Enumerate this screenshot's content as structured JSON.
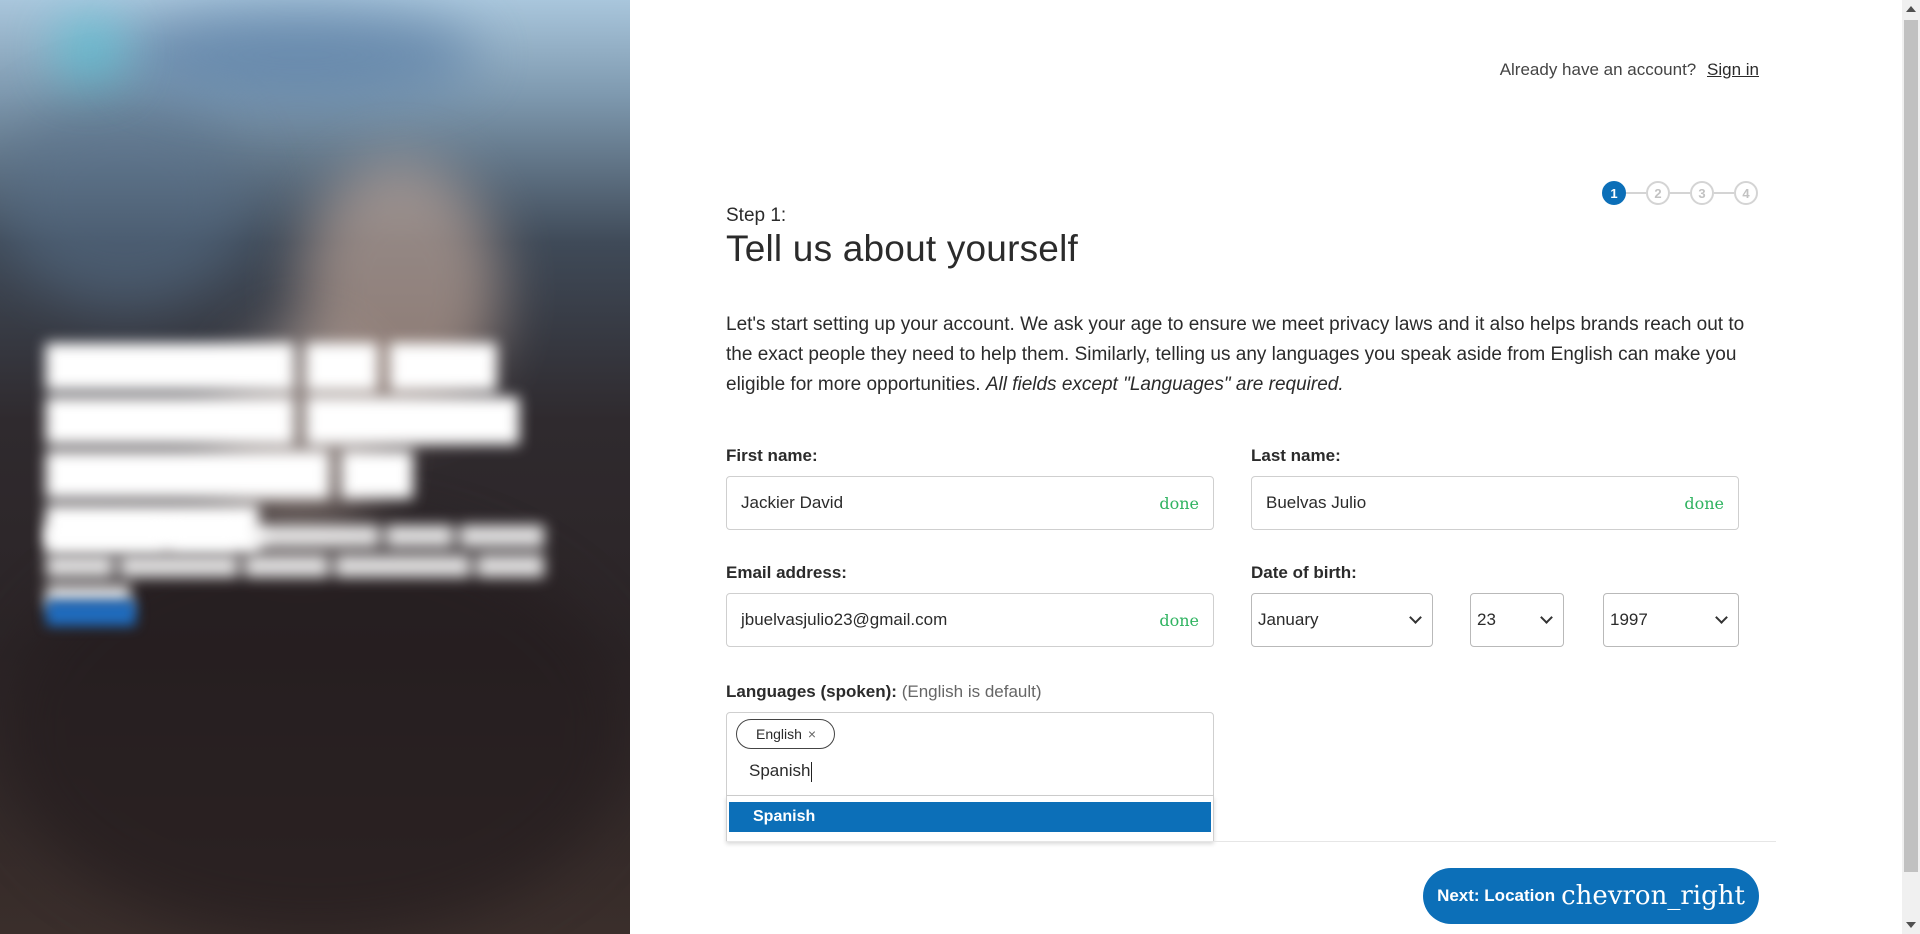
{
  "header": {
    "already_text": "Already have an account?",
    "signin_label": "Sign in"
  },
  "stepper": {
    "steps": [
      "1",
      "2",
      "3",
      "4"
    ],
    "current": 1
  },
  "step_label": "Step 1:",
  "title": "Tell us about yourself",
  "intro": {
    "text": "Let's start setting up your account. We ask your age to ensure we meet privacy laws and it also helps brands reach out to the exact people they need to help them. Similarly, telling us any languages you speak aside from English can make you eligible for more opportunities. ",
    "emphasis": "All fields except \"Languages\" are required."
  },
  "fields": {
    "first_name": {
      "label": "First name:",
      "value": "Jackier David",
      "status": "done"
    },
    "last_name": {
      "label": "Last name:",
      "value": "Buelvas Julio",
      "status": "done"
    },
    "email": {
      "label": "Email address:",
      "value": "jbuelvasjulio23@gmail.com",
      "status": "done"
    },
    "dob": {
      "label": "Date of birth:",
      "month": "January",
      "day": "23",
      "year": "1997"
    },
    "languages": {
      "label": "Languages (spoken):",
      "hint": "(English is default)",
      "chips": [
        "English"
      ],
      "chip_remove": "×",
      "input_value": "Spanish",
      "suggestions": [
        "Spanish"
      ]
    }
  },
  "next_button": {
    "label": "Next: Location",
    "icon": "chevron_right"
  },
  "colors": {
    "accent": "#0c6fb8",
    "done": "#2fb360"
  }
}
